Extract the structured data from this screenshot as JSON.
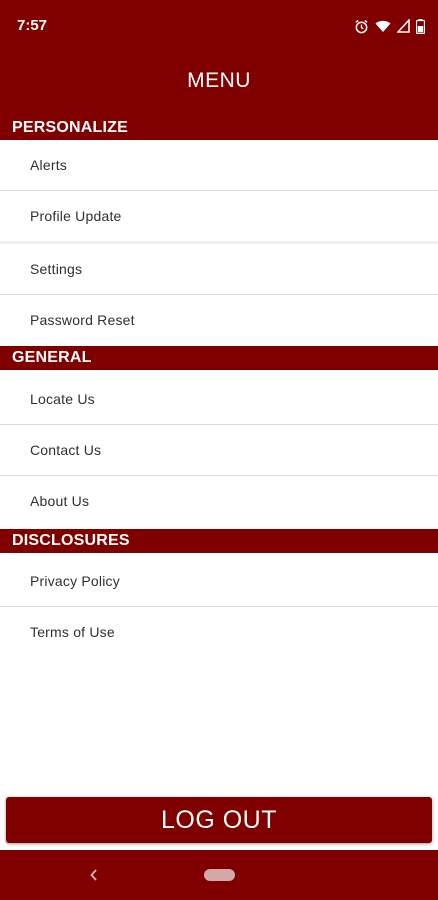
{
  "status_bar": {
    "time": "7:57",
    "icons": [
      "alarm-icon",
      "wifi-icon",
      "signal-icon",
      "battery-icon"
    ]
  },
  "header": {
    "title": "MENU"
  },
  "sections": [
    {
      "title": "PERSONALIZE",
      "items": [
        "Alerts",
        "Profile Update",
        "Settings",
        "Password Reset"
      ]
    },
    {
      "title": "GENERAL",
      "items": [
        "Locate Us",
        "Contact Us",
        "About Us"
      ]
    },
    {
      "title": "DISCLOSURES",
      "items": [
        "Privacy Policy",
        "Terms of Use"
      ]
    }
  ],
  "logout": {
    "label": "LOG OUT"
  },
  "nav_bar": {
    "back_icon": "back-icon",
    "home_icon": "home-pill-icon"
  },
  "colors": {
    "brand": "#800000",
    "text": "#303030",
    "divider": "#dcdcdc"
  }
}
